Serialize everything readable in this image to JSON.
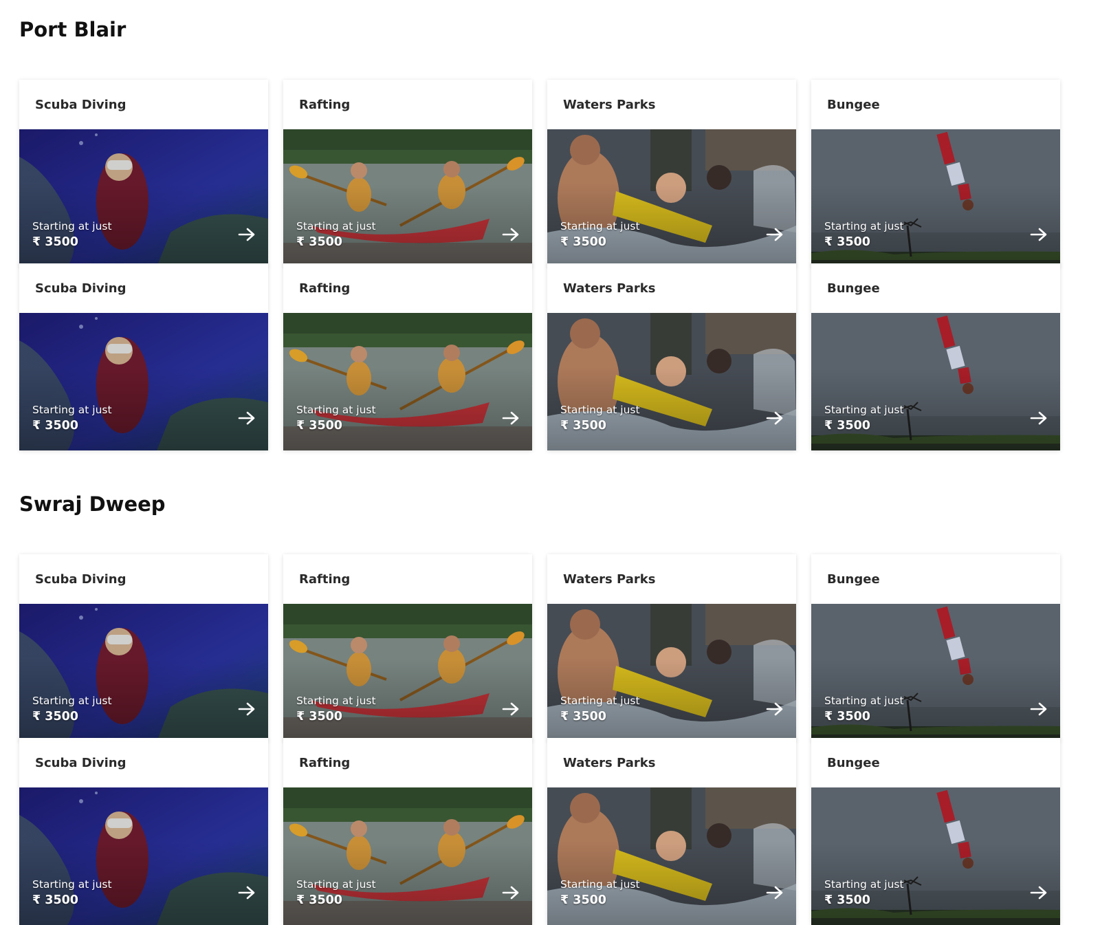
{
  "sections": [
    {
      "title": "Port Blair",
      "rows": [
        [
          {
            "name": "Scuba Diving",
            "theme": "scuba",
            "label": "Starting at just",
            "price": "₹ 3500"
          },
          {
            "name": "Rafting",
            "theme": "rafting",
            "label": "Starting at just",
            "price": "₹ 3500"
          },
          {
            "name": "Waters Parks",
            "theme": "waterpark",
            "label": "Starting at just",
            "price": "₹ 3500"
          },
          {
            "name": "Bungee",
            "theme": "bungee",
            "label": "Starting at just",
            "price": "₹ 3500"
          }
        ],
        [
          {
            "name": "Scuba Diving",
            "theme": "scuba",
            "label": "Starting at just",
            "price": "₹ 3500"
          },
          {
            "name": "Rafting",
            "theme": "rafting",
            "label": "Starting at just",
            "price": "₹ 3500"
          },
          {
            "name": "Waters Parks",
            "theme": "waterpark",
            "label": "Starting at just",
            "price": "₹ 3500"
          },
          {
            "name": "Bungee",
            "theme": "bungee",
            "label": "Starting at just",
            "price": "₹ 3500"
          }
        ]
      ]
    },
    {
      "title": "Swraj Dweep",
      "rows": [
        [
          {
            "name": "Scuba Diving",
            "theme": "scuba",
            "label": "Starting at just",
            "price": "₹ 3500"
          },
          {
            "name": "Rafting",
            "theme": "rafting",
            "label": "Starting at just",
            "price": "₹ 3500"
          },
          {
            "name": "Waters Parks",
            "theme": "waterpark",
            "label": "Starting at just",
            "price": "₹ 3500"
          },
          {
            "name": "Bungee",
            "theme": "bungee",
            "label": "Starting at just",
            "price": "₹ 3500"
          }
        ],
        [
          {
            "name": "Scuba Diving",
            "theme": "scuba",
            "label": "Starting at just",
            "price": "₹ 3500"
          },
          {
            "name": "Rafting",
            "theme": "rafting",
            "label": "Starting at just",
            "price": "₹ 3500"
          },
          {
            "name": "Waters Parks",
            "theme": "waterpark",
            "label": "Starting at just",
            "price": "₹ 3500"
          },
          {
            "name": "Bungee",
            "theme": "bungee",
            "label": "Starting at just",
            "price": "₹ 3500"
          }
        ]
      ]
    }
  ],
  "arrow_icon": "arrow-right-icon",
  "colors": {
    "scuba": "#24207a",
    "rafting": "#5a6a62",
    "waterpark": "#4c5660",
    "bungee": "#56606a"
  }
}
